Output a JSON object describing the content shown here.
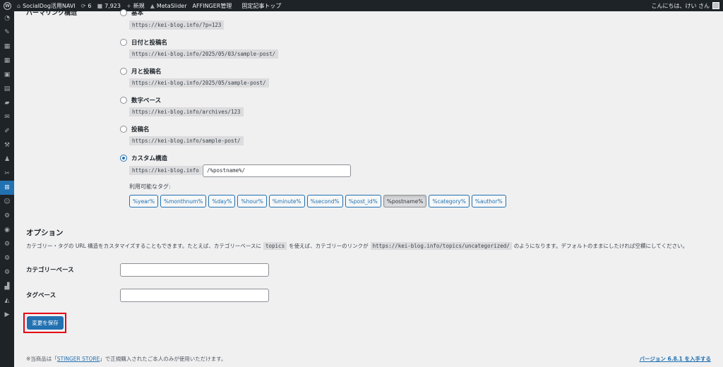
{
  "adminbar": {
    "site_name": "SocialDog活用NAVI",
    "updates_count": "6",
    "comments_count": "7,923",
    "new_label": "新規",
    "metaslider_label": "MetaSlider",
    "affinger_label": "AFFINGER管理",
    "fixed_top_label": "固定記事トップ",
    "greeting": "こんにちは、けい さん"
  },
  "permalink": {
    "section_heading": "パーマリンク構造",
    "options": [
      {
        "label": "基本",
        "example": "https://kei-blog.info/?p=123",
        "checked": false
      },
      {
        "label": "日付と投稿名",
        "example": "https://kei-blog.info/2025/05/03/sample-post/",
        "checked": false
      },
      {
        "label": "月と投稿名",
        "example": "https://kei-blog.info/2025/05/sample-post/",
        "checked": false
      },
      {
        "label": "数字ベース",
        "example": "https://kei-blog.info/archives/123",
        "checked": false
      },
      {
        "label": "投稿名",
        "example": "https://kei-blog.info/sample-post/",
        "checked": false
      },
      {
        "label": "カスタム構造",
        "checked": true
      }
    ],
    "custom_base": "https://kei-blog.info",
    "custom_value": "/%postname%/",
    "tags_label": "利用可能なタグ:",
    "tags": [
      "%year%",
      "%monthnum%",
      "%day%",
      "%hour%",
      "%minute%",
      "%second%",
      "%post_id%",
      "%postname%",
      "%category%",
      "%author%"
    ],
    "active_tag": "%postname%"
  },
  "options": {
    "title": "オプション",
    "desc_part1": "カテゴリー・タグの URL 構造をカスタマイズすることもできます。たとえば、カテゴリーベースに",
    "desc_code1": "topics",
    "desc_part2": "を使えば、カテゴリーのリンクが",
    "desc_code2": "https://kei-blog.info/topics/uncategorized/",
    "desc_part3": "のようになります。デフォルトのままにしたければ空欄にしてください。",
    "category_base_label": "カテゴリーベース",
    "category_base_value": "",
    "tag_base_label": "タグベース",
    "tag_base_value": ""
  },
  "save_label": "変更を保存",
  "footer": {
    "text_before": "※当商品は「",
    "store_link": "STINGER STORE",
    "text_after": "」で正規購入されたご本人のみが使用いただけます。",
    "version_link": "バージョン 6.8.1 を入手する"
  },
  "colors": {
    "accent": "#2271b1",
    "adminbar_bg": "#1d2327",
    "highlight": "#e60012"
  }
}
